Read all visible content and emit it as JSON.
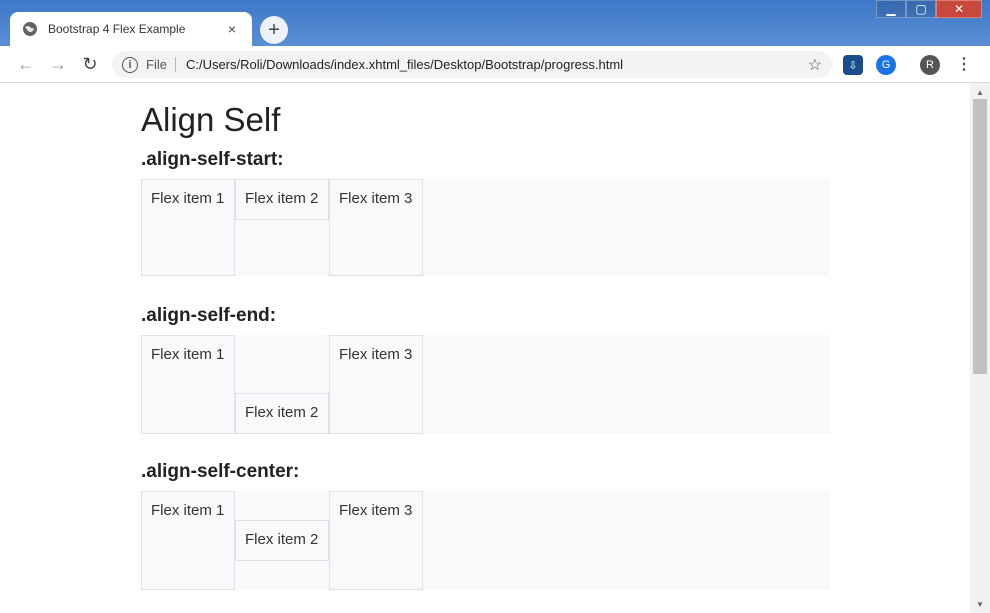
{
  "browser": {
    "tab_title": "Bootstrap 4 Flex Example",
    "tab_close": "×",
    "new_tab": "+",
    "omnibox_file": "File",
    "url": "C:/Users/Roli/Downloads/index.xhtml_files/Desktop/Bootstrap/progress.html",
    "avatar_letter": "R",
    "ext_letter": "G"
  },
  "page": {
    "heading": "Align Self",
    "sections": [
      {
        "title": ".align-self-start:",
        "items": [
          "Flex item 1",
          "Flex item 2",
          "Flex item 3"
        ]
      },
      {
        "title": ".align-self-end:",
        "items": [
          "Flex item 1",
          "Flex item 2",
          "Flex item 3"
        ]
      },
      {
        "title": ".align-self-center:",
        "items": [
          "Flex item 1",
          "Flex item 2",
          "Flex item 3"
        ]
      }
    ]
  },
  "colors": {
    "accent": "#1a73e8",
    "tab_bg": "#ffffff",
    "flex_bg": "#f8f9fa",
    "border": "#dee2e6"
  }
}
